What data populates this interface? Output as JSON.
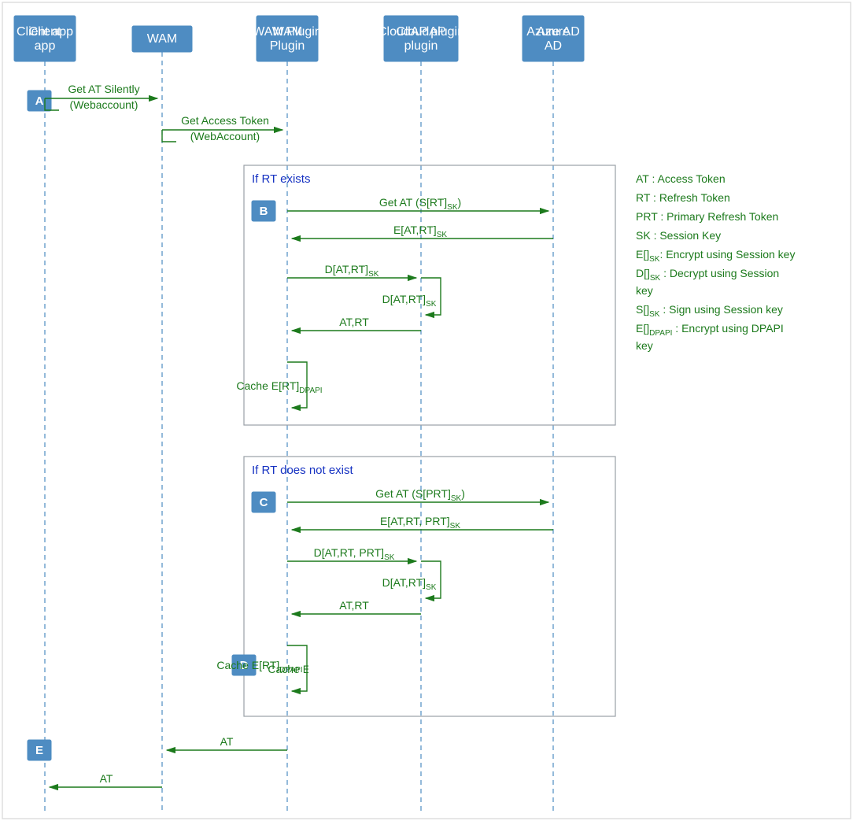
{
  "actors": {
    "client": "Client app",
    "wam": "WAM",
    "wamPlugin": "WAM Plugin",
    "cloudAP": "CloudAP plugin",
    "azureAD": "Azure AD"
  },
  "steps": {
    "A": "A",
    "B": "B",
    "C": "C",
    "D": "D",
    "E": "E"
  },
  "messages": {
    "m1a": "Get AT Silently",
    "m1b": "(Webaccount)",
    "m2a": "Get Access Token",
    "m2b": "(WebAccount)",
    "frame1_title": "If RT exists",
    "b1": "Get AT (S[RT]",
    "b1_sub": "SK",
    "b1_close": ")",
    "b2": "E[AT,RT]",
    "b2_sub": "SK",
    "b3": "D[AT,RT]",
    "b3_sub": "SK",
    "b4": "D[AT,RT]",
    "b4_sub": "SK",
    "b5": "AT,RT",
    "b6": "Cache E[RT]",
    "b6_sub": "DPAPI",
    "frame2_title": "If RT does not exist",
    "c1": "Get AT (S[PRT]",
    "c1_sub": "SK",
    "c1_close": ")",
    "c2": "E[AT,RT, PRT]",
    "c2_sub": "SK",
    "c3": "D[AT,RT, PRT]",
    "c3_sub": "SK",
    "c4": "D[AT,RT]",
    "c4_sub": "SK",
    "c5": "AT,RT",
    "c6": "Cache E[RT]",
    "c6_sub": "DPAPI",
    "e1": "AT",
    "e2": "AT"
  },
  "legend": {
    "l1": "AT : Access Token",
    "l2": "RT : Refresh Token",
    "l3": "PRT : Primary Refresh Token",
    "l4": "SK : Session Key",
    "l5a": "E[]",
    "l5s": "SK",
    "l5b": ": Encrypt using Session key",
    "l6a": "D[]",
    "l6s": "SK",
    "l6b": " : Decrypt using Session",
    "l6c": "key",
    "l7a": "S[]",
    "l7s": "SK",
    "l7b": " : Sign using Session key",
    "l8a": "E[]",
    "l8s": "DPAPI",
    "l8b": " : Encrypt using DPAPI",
    "l8c": "key"
  },
  "chart_data": {
    "type": "sequence-diagram",
    "actors": [
      "Client app",
      "WAM",
      "WAM Plugin",
      "CloudAP plugin",
      "Azure AD"
    ],
    "steps": [
      {
        "id": "A",
        "from": "Client app",
        "to": "WAM",
        "label": "Get AT Silently (Webaccount)"
      },
      {
        "from": "WAM",
        "to": "WAM Plugin",
        "label": "Get Access Token (WebAccount)"
      },
      {
        "frame": "If RT exists",
        "id": "B",
        "messages": [
          {
            "from": "WAM Plugin",
            "to": "Azure AD",
            "label": "Get AT (S[RT]_SK)"
          },
          {
            "from": "Azure AD",
            "to": "WAM Plugin",
            "label": "E[AT,RT]_SK"
          },
          {
            "from": "WAM Plugin",
            "to": "CloudAP plugin",
            "label": "D[AT,RT]_SK"
          },
          {
            "from": "CloudAP plugin",
            "to": "CloudAP plugin",
            "label": "D[AT,RT]_SK",
            "self": true
          },
          {
            "from": "CloudAP plugin",
            "to": "WAM Plugin",
            "label": "AT,RT"
          },
          {
            "from": "WAM Plugin",
            "to": "WAM Plugin",
            "label": "Cache E[RT]_DPAPI",
            "self": true
          }
        ]
      },
      {
        "frame": "If RT does not exist",
        "id": "C",
        "messages": [
          {
            "from": "WAM Plugin",
            "to": "Azure AD",
            "label": "Get AT (S[PRT]_SK)"
          },
          {
            "from": "Azure AD",
            "to": "WAM Plugin",
            "label": "E[AT,RT, PRT]_SK"
          },
          {
            "from": "WAM Plugin",
            "to": "CloudAP plugin",
            "label": "D[AT,RT, PRT]_SK"
          },
          {
            "from": "CloudAP plugin",
            "to": "CloudAP plugin",
            "label": "D[AT,RT]_SK",
            "self": true
          },
          {
            "from": "CloudAP plugin",
            "to": "WAM Plugin",
            "label": "AT,RT"
          },
          {
            "id": "D",
            "from": "WAM Plugin",
            "to": "WAM Plugin",
            "label": "Cache E[RT]_DPAPI",
            "self": true
          }
        ]
      },
      {
        "id": "E",
        "from": "WAM Plugin",
        "to": "WAM",
        "label": "AT"
      },
      {
        "from": "WAM",
        "to": "Client app",
        "label": "AT"
      }
    ],
    "legend": [
      "AT : Access Token",
      "RT : Refresh Token",
      "PRT : Primary Refresh Token",
      "SK : Session Key",
      "E[]_SK: Encrypt using Session key",
      "D[]_SK : Decrypt using Session key",
      "S[]_SK : Sign using Session key",
      "E[]_DPAPI : Encrypt using DPAPI key"
    ]
  }
}
